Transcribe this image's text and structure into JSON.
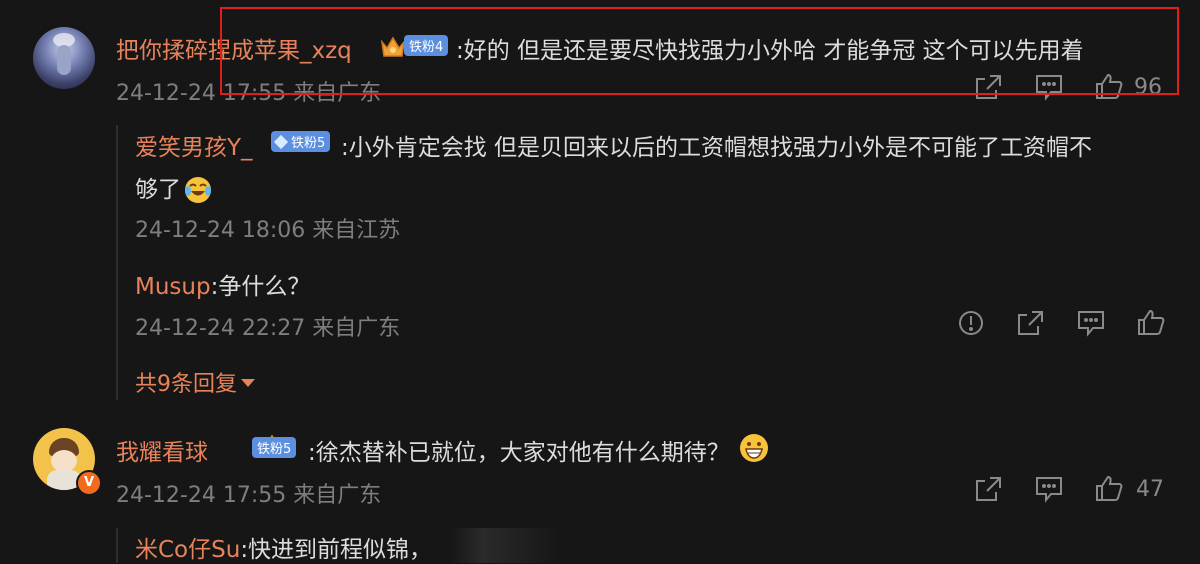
{
  "comments": [
    {
      "username": "把你揉碎捏成苹果_xzq",
      "badge": "铁粉4",
      "text": ":好的 但是还是要尽快找强力小外哈 才能争冠 这个可以先用着",
      "timestamp": "24-12-24 17:55 来自广东",
      "likes": "96"
    },
    {
      "username": "我耀看球",
      "badge": "铁粉5",
      "text": ":徐杰替补已就位，大家对他有什么期待？",
      "timestamp": "24-12-24 17:55 来自广东",
      "likes": "47"
    }
  ],
  "replies": [
    {
      "username": "爱笑男孩Y_",
      "badge": "铁粉5",
      "text_line1": ":小外肯定会找 但是贝回来以后的工资帽想找强力小外是不可能了工资帽不",
      "text_line2": "够了",
      "timestamp": "24-12-24 18:06 来自江苏"
    },
    {
      "username": "Musup",
      "text": ":争什么？",
      "timestamp": "24-12-24 22:27 来自广东"
    },
    {
      "username": "米Co仔Su",
      "text": ":快进到前程似锦，"
    }
  ],
  "more_replies_label": "共9条回复",
  "colors": {
    "background": "#161616",
    "username": "#e8825a",
    "badge": "#5c8fe0",
    "highlight_box": "#e01e1e"
  },
  "icons": [
    "share-icon",
    "comment-icon",
    "like-icon",
    "report-icon",
    "crown-icon",
    "diamond-icon",
    "emoji-laugh-cry",
    "emoji-grin"
  ]
}
